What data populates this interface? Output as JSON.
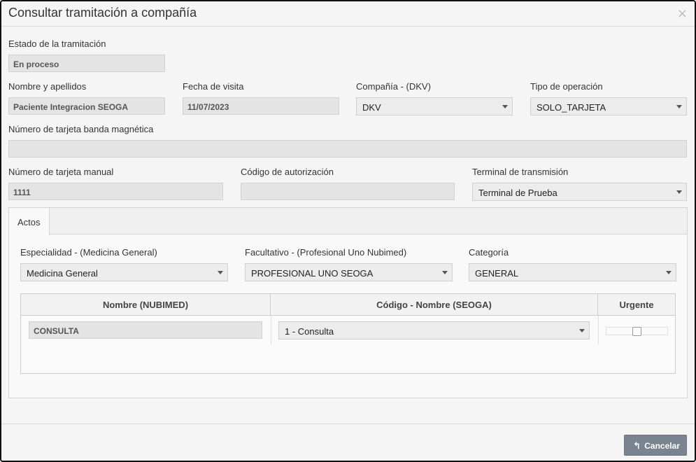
{
  "modal": {
    "title": "Consultar tramitación a compañía",
    "close_glyph": "×"
  },
  "form": {
    "estado": {
      "label": "Estado de la tramitación",
      "value": "En proceso"
    },
    "nombre": {
      "label": "Nombre y apellidos",
      "value": "Paciente Integracion SEOGA"
    },
    "fecha": {
      "label": "Fecha de visita",
      "value": "11/07/2023"
    },
    "compania": {
      "label": "Compañía - (DKV)",
      "value": "DKV"
    },
    "tipo_operacion": {
      "label": "Tipo de operación",
      "value": "SOLO_TARJETA"
    },
    "tarjeta_banda": {
      "label": "Número de tarjeta banda magnética",
      "value": ""
    },
    "tarjeta_manual": {
      "label": "Número de tarjeta manual",
      "value": "1111"
    },
    "codigo_autorizacion": {
      "label": "Código de autorización",
      "value": ""
    },
    "terminal": {
      "label": "Terminal de transmisión",
      "value": "Terminal de Prueba"
    }
  },
  "tabs": [
    {
      "label": "Actos",
      "active": true
    }
  ],
  "actos": {
    "especialidad": {
      "label": "Especialidad - (Medicina General)",
      "value": "Medicina General"
    },
    "facultativo": {
      "label": "Facultativo - (Profesional Uno Nubimed)",
      "value": "PROFESIONAL UNO SEOGA"
    },
    "categoria": {
      "label": "Categoría",
      "value": "GENERAL"
    },
    "grid": {
      "columns": [
        "Nombre (NUBIMED)",
        "Código - Nombre (SEOGA)",
        "Urgente"
      ],
      "rows": [
        {
          "nombre": "CONSULTA",
          "codigo": "1 - Consulta",
          "urgente": false
        }
      ]
    }
  },
  "footer": {
    "cancel_label": "Cancelar",
    "cancel_icon": "reply-arrow-icon"
  }
}
